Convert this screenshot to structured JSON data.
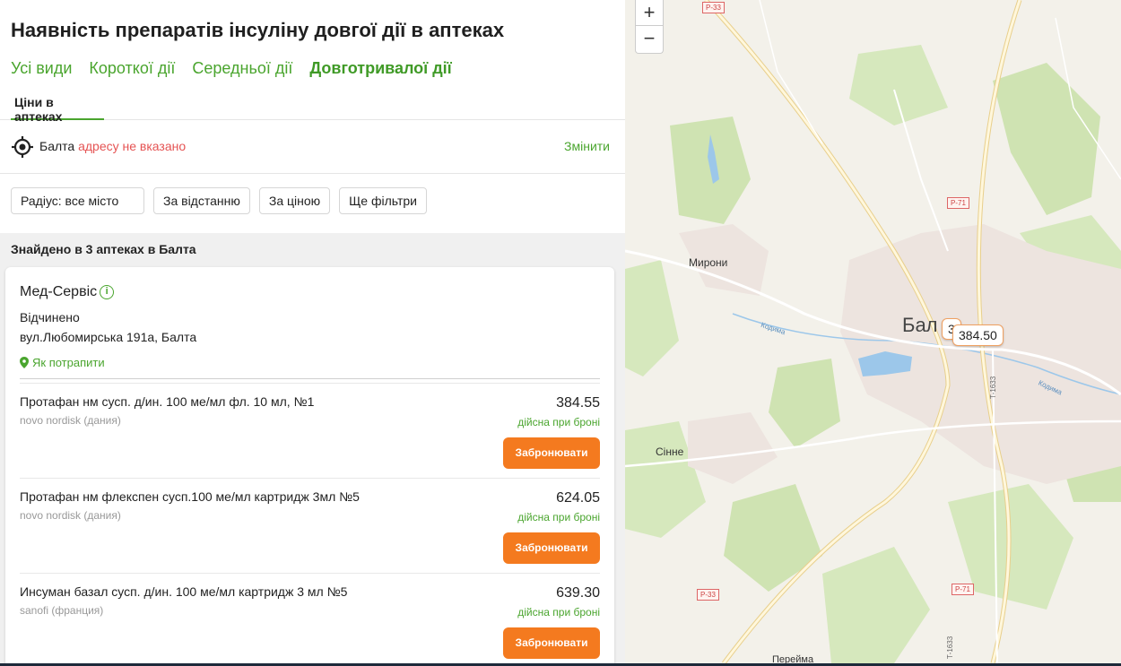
{
  "header": {
    "title": "Наявність препаратів інсуліну довгої дії в аптеках",
    "type_tabs": [
      {
        "label": "Усі види"
      },
      {
        "label": "Короткої дії"
      },
      {
        "label": "Середньої дії"
      },
      {
        "label": "Довготривалої дії"
      }
    ],
    "sub_tab": "Ціни в аптеках"
  },
  "location": {
    "city": "Балта",
    "warning": "адресу не вказано",
    "change_label": "Змінити"
  },
  "filters": [
    {
      "label": "Радіус: все місто"
    },
    {
      "label": "За відстанню"
    },
    {
      "label": "За ціною"
    },
    {
      "label": "Ще фільтри"
    }
  ],
  "results": {
    "found_text": "Знайдено в 3 аптеках в Балта",
    "pharmacy": {
      "name": "Мед-Сервіс",
      "status": "Відчинено",
      "address": "вул.Любомирська 191а, Балта",
      "route_label": "Як потрапити"
    },
    "products": [
      {
        "name": "Протафан нм сусп. д/ин. 100 ме/мл фл. 10 мл, №1",
        "maker": "novo nordisk (дания)",
        "price": "384.55",
        "note": "дійсна при броні",
        "button": "Забронювати"
      },
      {
        "name": "Протафан нм флекспен сусп.100 ме/мл картридж 3мл №5",
        "maker": "novo nordisk (дания)",
        "price": "624.05",
        "note": "дійсна при броні",
        "button": "Забронювати"
      },
      {
        "name": "Инсуман базал сусп. д/ин. 100 ме/мл картридж 3 мл №5",
        "maker": "sanofi (франция)",
        "price": "639.30",
        "note": "дійсна при броні",
        "button": "Забронювати"
      }
    ]
  },
  "map": {
    "zoom_in": "+",
    "zoom_out": "−",
    "labels": {
      "myrony": "Мирони",
      "balta": "Бал",
      "sinne": "Сінне",
      "kodyma1": "Кодима",
      "kodyma2": "Кодима",
      "t1633": "Т-1633",
      "t1633b": "Т-1633",
      "bottom": "Перейма"
    },
    "road_badges": [
      "Р-33",
      "Р-71",
      "Р-33",
      "Р-71"
    ],
    "price_tags": {
      "back": "3",
      "front": "384.50"
    }
  },
  "colors": {
    "accent": "#4aa52e",
    "button": "#f47a1f",
    "warning": "#e55353"
  }
}
